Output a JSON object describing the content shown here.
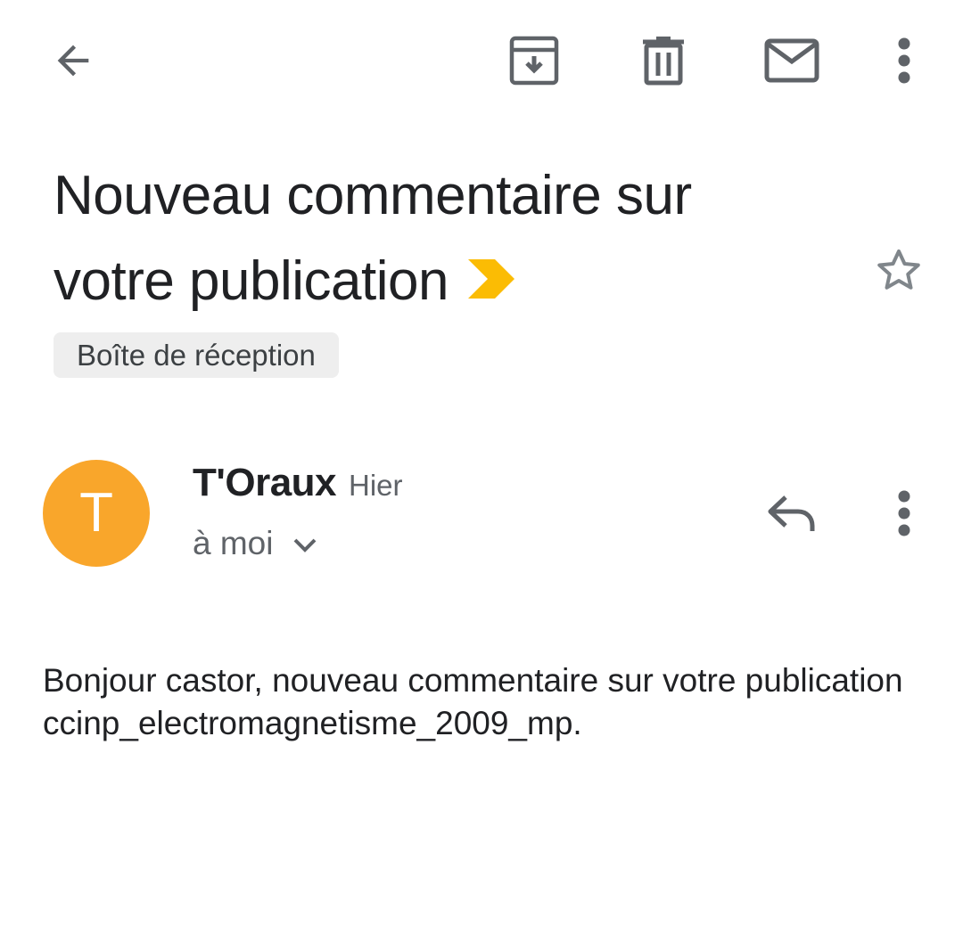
{
  "toolbar": {
    "back_icon": "arrow-back-icon",
    "archive_icon": "archive-icon",
    "delete_icon": "delete-icon",
    "mark_unread_icon": "mail-icon",
    "more_icon": "more-vert-icon"
  },
  "email": {
    "subject": "Nouveau commentaire sur votre publication",
    "importance_color": "#fbbc04",
    "starred": false,
    "label": "Boîte de réception",
    "sender": {
      "initial": "T",
      "avatar_color": "#f9a62b",
      "name": "T'Oraux",
      "date": "Hier",
      "recipients": "à moi"
    },
    "body": "Bonjour castor, nouveau commentaire sur votre publication ccinp_electromagnetisme_2009_mp."
  }
}
